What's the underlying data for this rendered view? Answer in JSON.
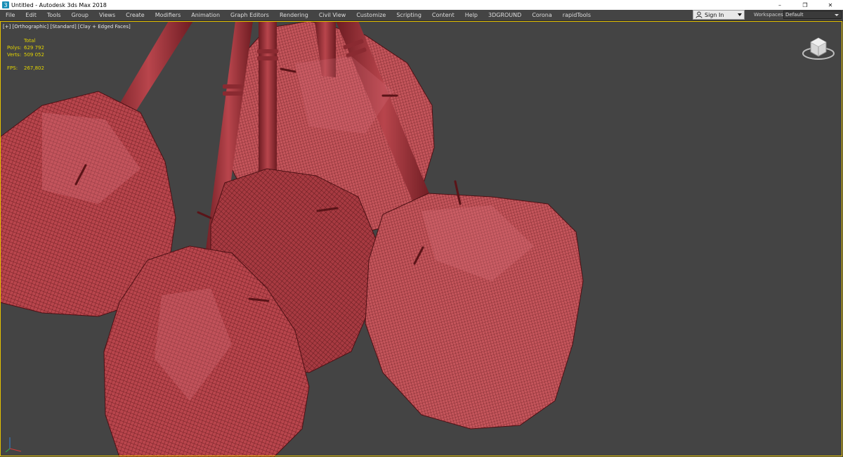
{
  "titlebar": {
    "title": "Untitled - Autodesk 3ds Max 2018",
    "minimize_glyph": "–",
    "restore_glyph": "❐",
    "close_glyph": "✕"
  },
  "menu": [
    "File",
    "Edit",
    "Tools",
    "Group",
    "Views",
    "Create",
    "Modifiers",
    "Animation",
    "Graph Editors",
    "Rendering",
    "Civil View",
    "Customize",
    "Scripting",
    "Content",
    "Help",
    "3DGROUND",
    "Corona",
    "rapidTools"
  ],
  "account": {
    "signin_label": "Sign In"
  },
  "workspaces": {
    "label": "Workspaces:",
    "value": "Default"
  },
  "viewport": {
    "labels": "[+] [Orthographic] [Standard] [Clay + Edged Faces]",
    "stats": {
      "total_label": "Total",
      "polys_label": "Polys:",
      "polys_value": "629 792",
      "verts_label": "Verts:",
      "verts_value": "509 052",
      "fps_label": "FPS:",
      "fps_value": "267,802"
    }
  },
  "colors": {
    "viewport_bg": "#444444",
    "viewport_border": "#e4c100",
    "stats_text": "#e3d400",
    "mesh_fill": "#b8454c",
    "mesh_wire": "#5a1418"
  }
}
